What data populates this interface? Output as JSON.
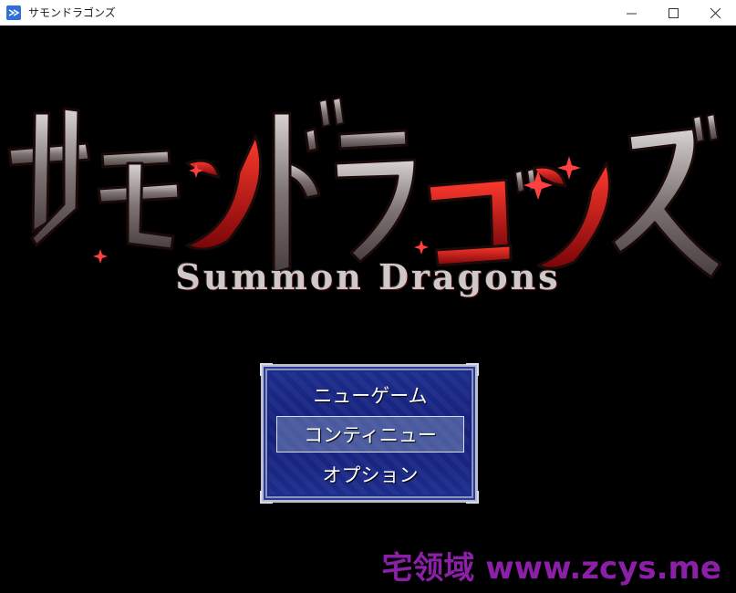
{
  "window": {
    "title": "サモンドラゴンズ"
  },
  "logo": {
    "japanese_title": "サモンドラゴンズ",
    "subtitle": "Summon Dragons"
  },
  "menu": {
    "items": [
      {
        "label": "ニューゲーム"
      },
      {
        "label": "コンティニュー",
        "selected": true
      },
      {
        "label": "オプション"
      }
    ]
  },
  "watermark": {
    "text": "宅领域 www.zcys.me"
  },
  "colors": {
    "menu_bg": "#1a2788",
    "logo_red": "#c0141c",
    "logo_metal": "#9a9090",
    "watermark": "#8b1fa8"
  }
}
